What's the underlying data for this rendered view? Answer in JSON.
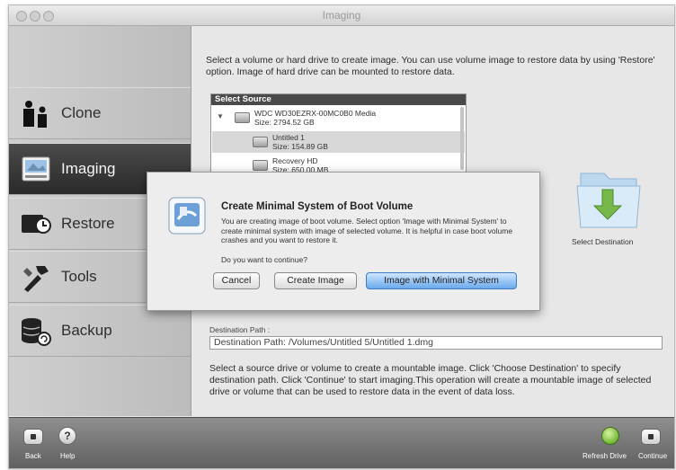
{
  "window": {
    "title": "Imaging"
  },
  "sidebar": {
    "items": [
      {
        "label": "Clone",
        "active": false,
        "icon": "people-icon"
      },
      {
        "label": "Imaging",
        "active": true,
        "icon": "disk-image-icon"
      },
      {
        "label": "Restore",
        "active": false,
        "icon": "restore-drive-icon"
      },
      {
        "label": "Tools",
        "active": false,
        "icon": "tools-icon"
      },
      {
        "label": "Backup",
        "active": false,
        "icon": "backup-database-icon"
      }
    ]
  },
  "main": {
    "intro": "Select a volume or hard drive to create image. You can use volume image to restore data by using 'Restore' option. Image of hard drive can be mounted to restore data.",
    "source_list": {
      "header": "Select Source",
      "items": [
        {
          "name": "WDC WD30EZRX-00MC0B0 Media",
          "size": "Size: 2794.52 GB"
        },
        {
          "name": "Untitled 1",
          "size": "Size: 154.89 GB"
        },
        {
          "name": "Recovery HD",
          "size": "Size: 650.00 MB"
        }
      ]
    },
    "select_destination": "Select Destination",
    "destination_path_label": "Destination Path :",
    "destination_path_value": "Destination Path: /Volumes/Untitled 5/Untitled 1.dmg",
    "bottom_text": "Select a source drive or volume to create a mountable image. Click 'Choose Destination' to specify destination path. Click 'Continue' to start imaging.This operation will create a mountable image of selected drive or volume that can be used to restore data in the event of data loss."
  },
  "footer": {
    "back": "Back",
    "help": "Help",
    "refresh": "Refresh Drive",
    "continue": "Continue"
  },
  "dialog": {
    "title": "Create Minimal System of Boot Volume",
    "body": "You are creating image of boot volume. Select option 'Image with Minimal System' to create minimal system with image of selected volume. It is helpful in case boot volume crashes and you want to restore it.",
    "question": "Do you want to continue?",
    "buttons": {
      "cancel": "Cancel",
      "create": "Create Image",
      "minimal": "Image with Minimal System"
    }
  },
  "colors": {
    "accent": "#5b9ee6",
    "sidebar_active": "#333333",
    "refresh_green": "#7fc241"
  }
}
